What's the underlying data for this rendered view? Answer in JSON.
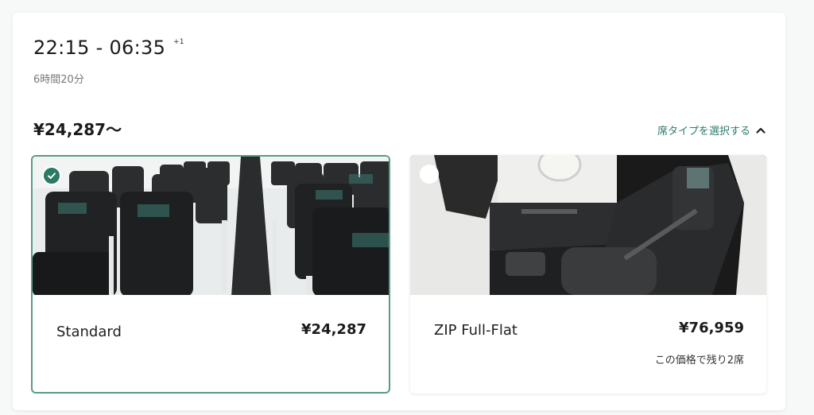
{
  "flight": {
    "time_range": "22:15 - 06:35",
    "day_offset": "+1",
    "duration": "6時間20分"
  },
  "price_from": "¥24,287〜",
  "select_seat_type": {
    "label": "席タイプを選択する",
    "icon": "chevron-up-icon"
  },
  "seat_options": [
    {
      "name": "Standard",
      "price": "¥24,287",
      "note": "",
      "selected": true,
      "image": "economy-cabin-photo"
    },
    {
      "name": "ZIP Full-Flat",
      "price": "¥76,959",
      "note": "この価格で残り2席",
      "selected": false,
      "image": "full-flat-seat-photo"
    }
  ],
  "colors": {
    "accent": "#2b7a63",
    "link": "#2d7a6c",
    "selected_border": "#5a9b8a"
  }
}
